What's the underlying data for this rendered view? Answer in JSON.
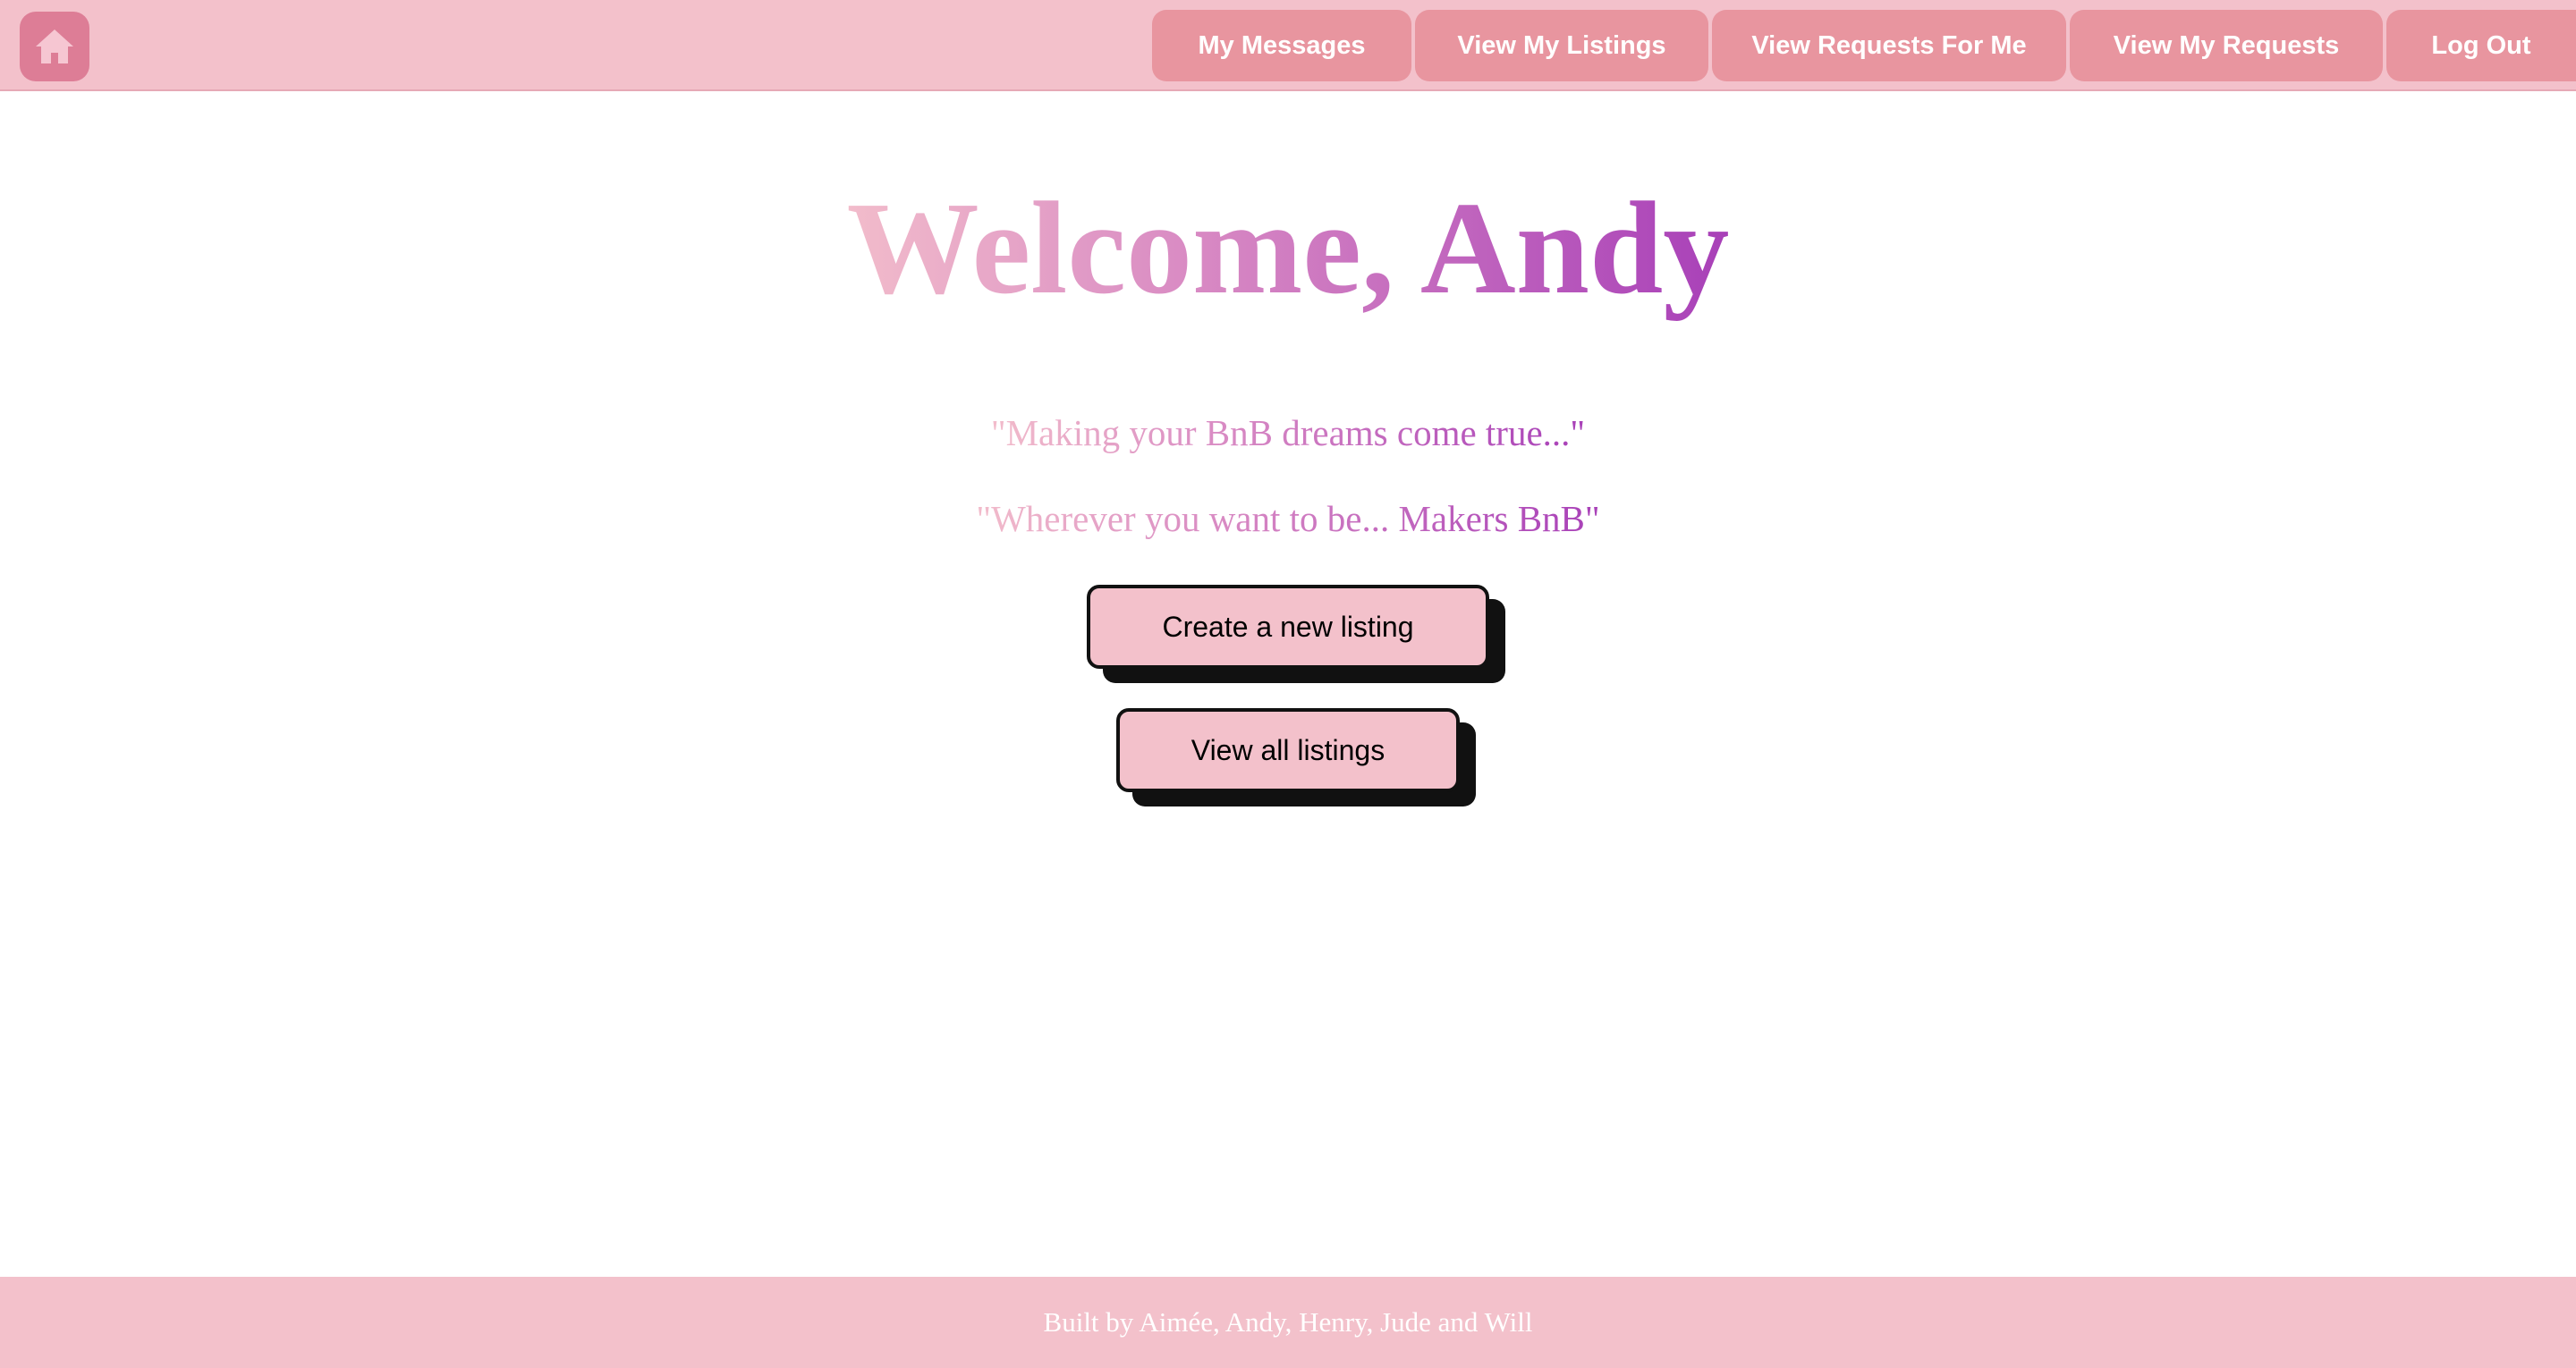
{
  "nav": {
    "home_icon": "home-icon",
    "links": [
      {
        "label": "My Messages"
      },
      {
        "label": "View My Listings"
      },
      {
        "label": "View Requests For Me"
      },
      {
        "label": "View My Requests"
      },
      {
        "label": "Log Out"
      }
    ]
  },
  "main": {
    "welcome": "Welcome, Andy",
    "taglines": [
      "\"Making your BnB dreams come true...\"",
      "\"Wherever you want to be... Makers BnB\""
    ],
    "buttons": {
      "create_label": "Create a new listing",
      "view_all_label": "View all listings"
    }
  },
  "footer": {
    "text": "Built by Aimée, Andy, Henry, Jude and Will"
  },
  "colors": {
    "nav_background": "#f3c1cb",
    "nav_button": "#e8959f",
    "home_button": "#dd7d96",
    "gradient_start": "#f2bccb",
    "gradient_end": "#a840b8",
    "button_fill": "#f3c1cb",
    "button_shadow": "#111111"
  }
}
